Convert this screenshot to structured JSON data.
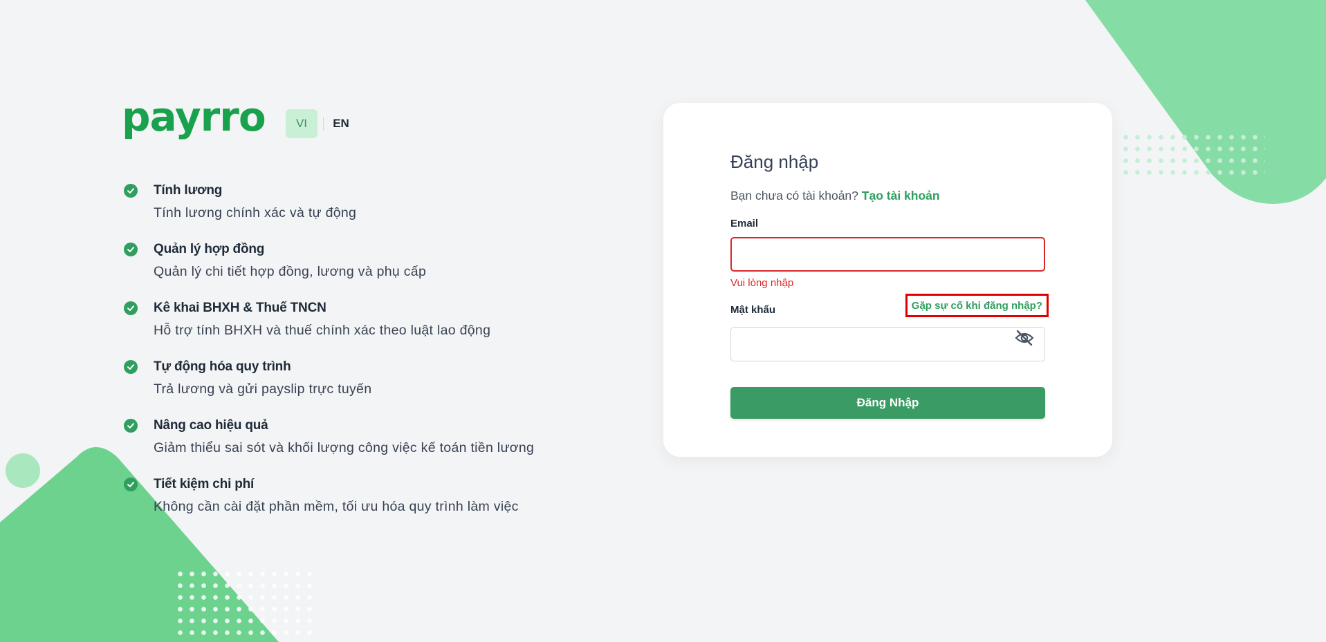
{
  "brand": {
    "logo_text": "payrro",
    "accent_color": "#2f9e5e",
    "logo_color": "#1aa14d",
    "error_color": "#dc2626"
  },
  "language": {
    "options": [
      {
        "label": "VI",
        "selected": true
      },
      {
        "label": "EN",
        "selected": false
      }
    ]
  },
  "features": [
    {
      "title": "Tính lương",
      "description": "Tính lương chính xác và tự động",
      "icon": "check-circle-icon"
    },
    {
      "title": "Quản lý hợp đồng",
      "description": "Quản lý chi tiết hợp đồng, lương và phụ cấp",
      "icon": "check-circle-icon"
    },
    {
      "title": "Kê khai BHXH & Thuế TNCN",
      "description": "Hỗ trợ tính BHXH và thuế chính xác theo luật lao động",
      "icon": "check-circle-icon"
    },
    {
      "title": "Tự động hóa quy trình",
      "description": "Trả lương và gửi payslip trực tuyến",
      "icon": "check-circle-icon"
    },
    {
      "title": "Nâng cao hiệu quả",
      "description": "Giảm thiểu sai sót và khối lượng công việc kế toán tiền lương",
      "icon": "check-circle-icon"
    },
    {
      "title": "Tiết kiệm chi phí",
      "description": "Không cần cài đặt phần mềm, tối ưu hóa quy trình làm việc",
      "icon": "check-circle-icon"
    }
  ],
  "login": {
    "title": "Đăng nhập",
    "no_account_text": "Bạn chưa có tài khoản?",
    "create_account_link": "Tạo tài khoản",
    "email": {
      "label": "Email",
      "value": "",
      "error": "Vui lòng nhập"
    },
    "password": {
      "label": "Mật khẩu",
      "value": "",
      "toggle_icon": "eye-off-icon"
    },
    "trouble_link": "Gặp sự cố khi đăng nhập?",
    "submit_label": "Đăng Nhập"
  }
}
